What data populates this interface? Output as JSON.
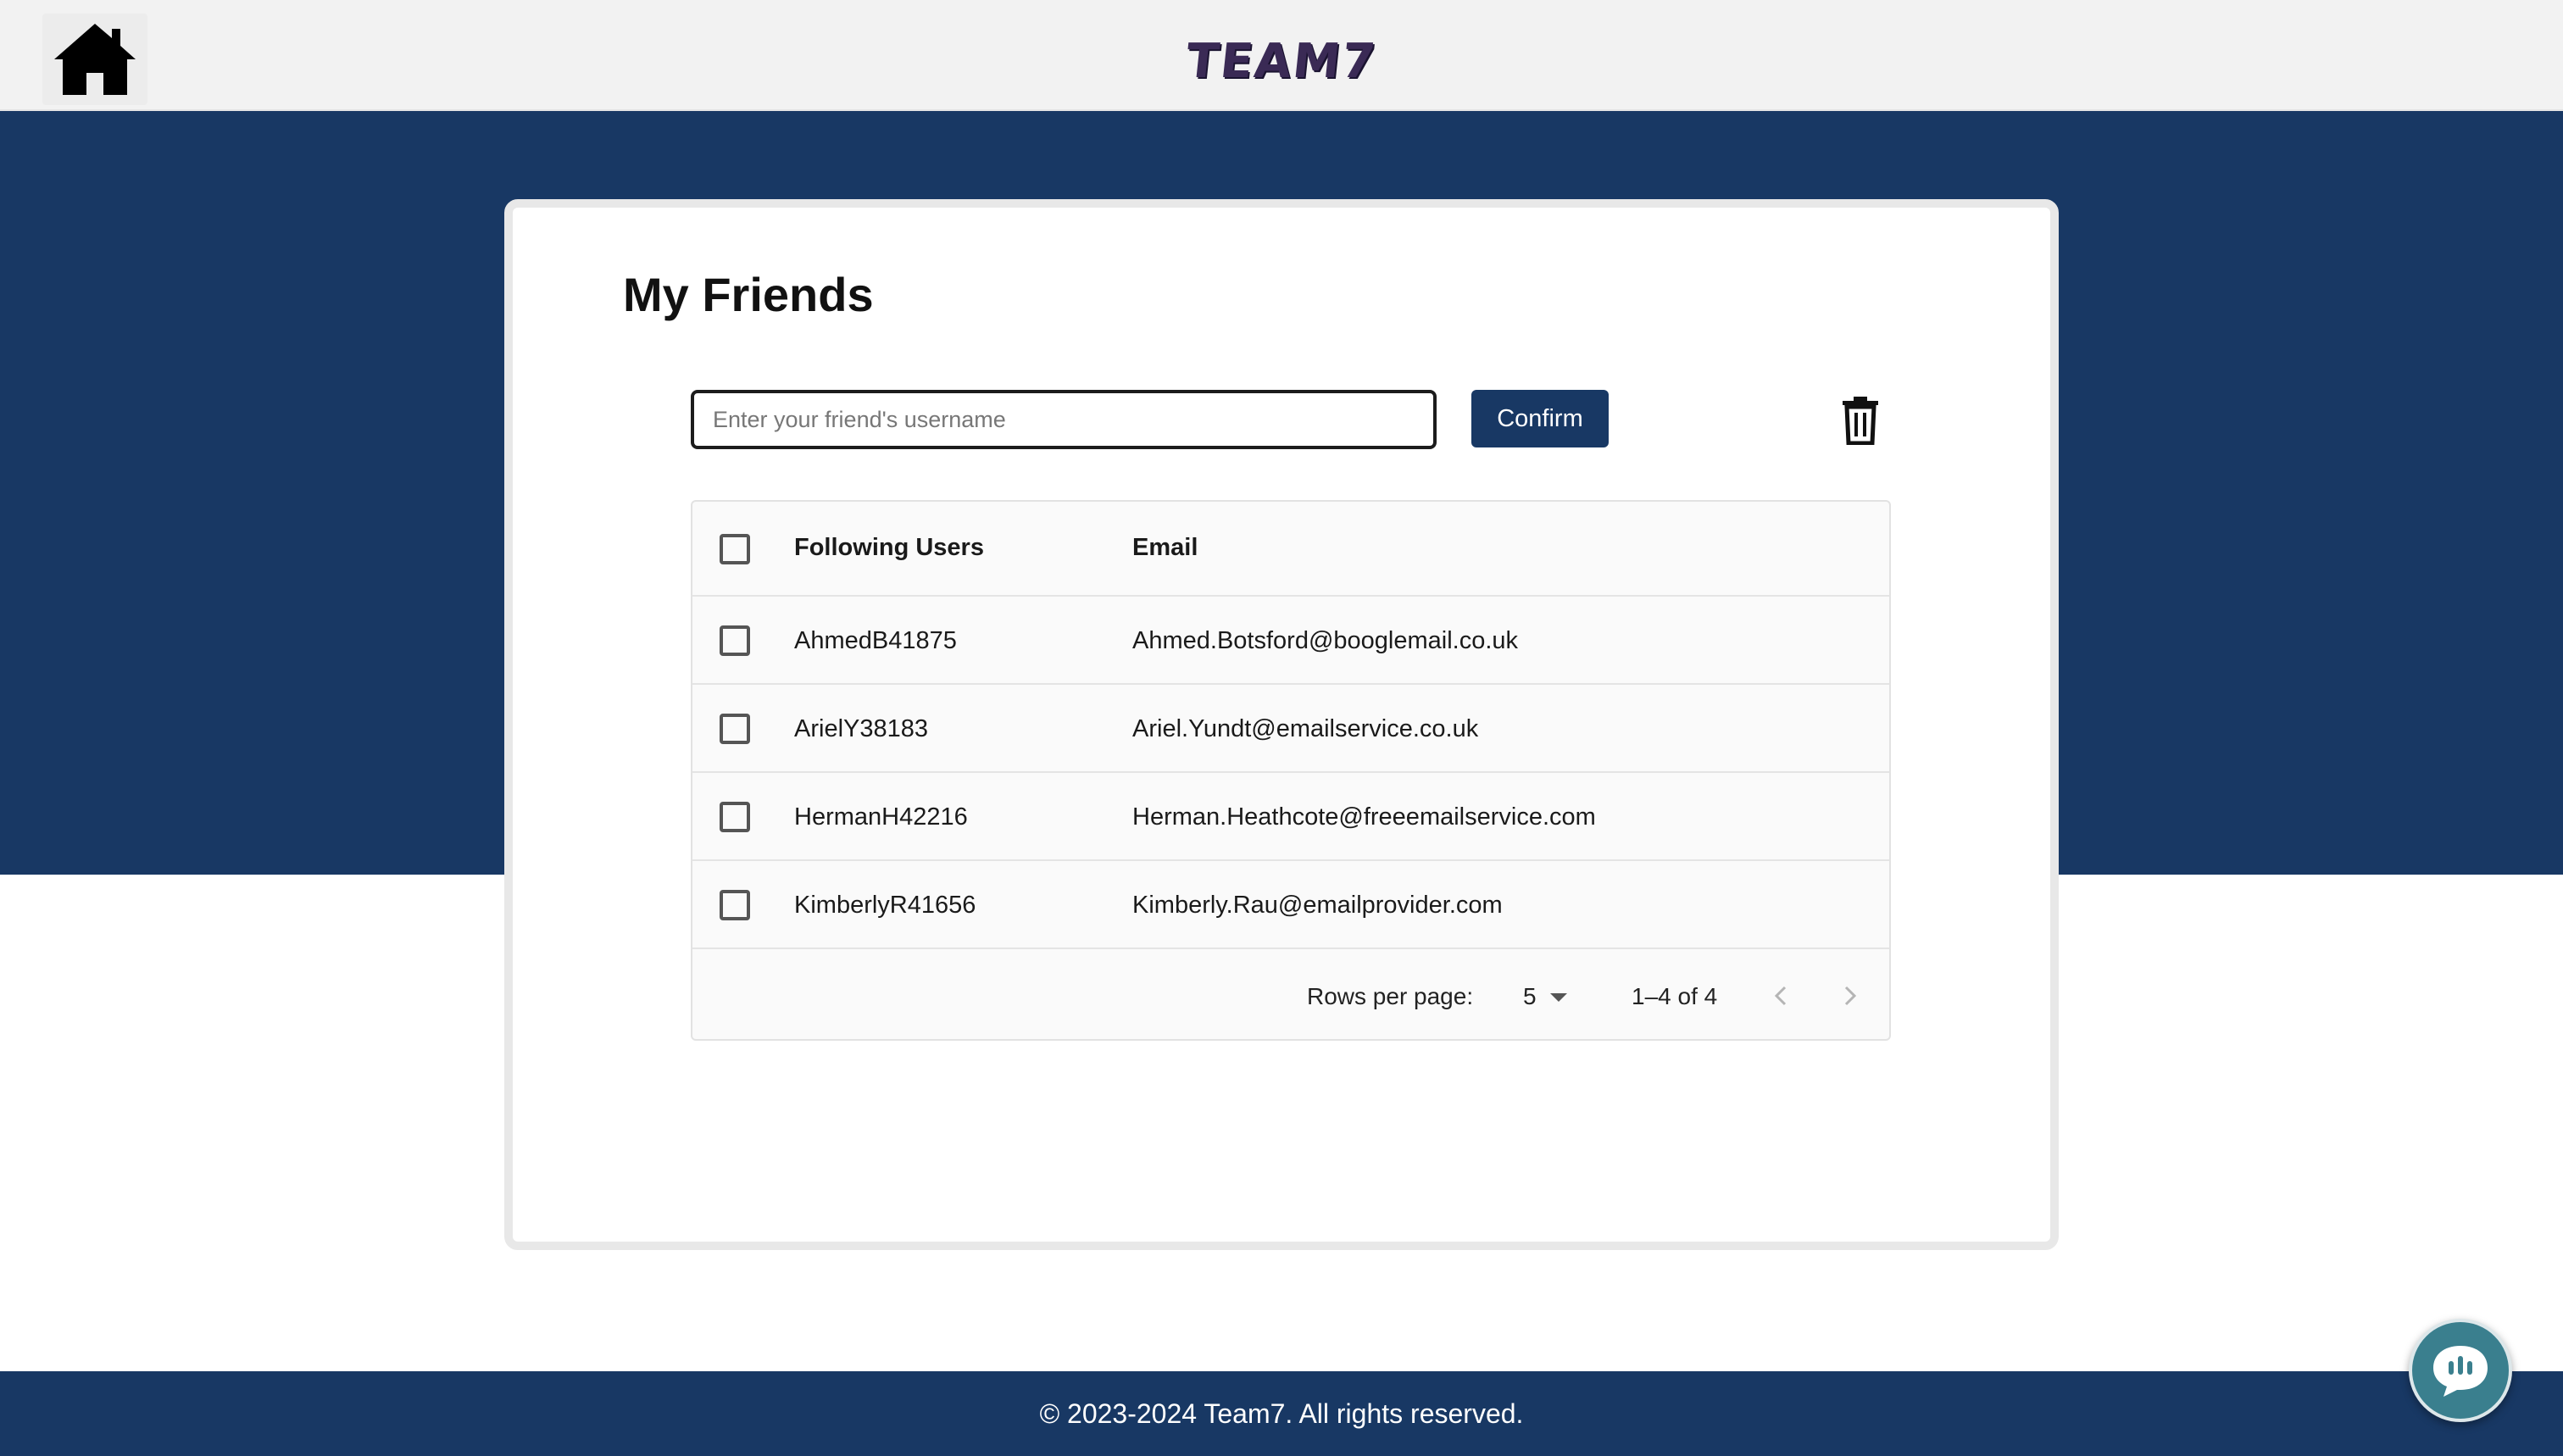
{
  "header": {
    "home_icon": "home-icon",
    "logo_text": "TEAM7"
  },
  "main": {
    "title": "My Friends",
    "search": {
      "placeholder": "Enter your friend's username",
      "value": ""
    },
    "confirm_label": "Confirm",
    "delete_icon": "trash-icon",
    "table": {
      "columns": [
        "Following Users",
        "Email"
      ],
      "rows": [
        {
          "username": "AhmedB41875",
          "email": "Ahmed.Botsford@booglemail.co.uk",
          "checked": false
        },
        {
          "username": "ArielY38183",
          "email": "Ariel.Yundt@emailservice.co.uk",
          "checked": false
        },
        {
          "username": "HermanH42216",
          "email": "Herman.Heathcote@freeemailservice.com",
          "checked": false
        },
        {
          "username": "KimberlyR41656",
          "email": "Kimberly.Rau@emailprovider.com",
          "checked": false
        }
      ],
      "pagination": {
        "rows_per_page_label": "Rows per page:",
        "rows_per_page": "5",
        "range": "1–4 of 4"
      }
    }
  },
  "footer": {
    "text": "© 2023-2024 Team7. All rights reserved."
  },
  "chat_icon": "chat-icon",
  "colors": {
    "primary": "#183864",
    "chat_button": "#3a7f8e"
  }
}
